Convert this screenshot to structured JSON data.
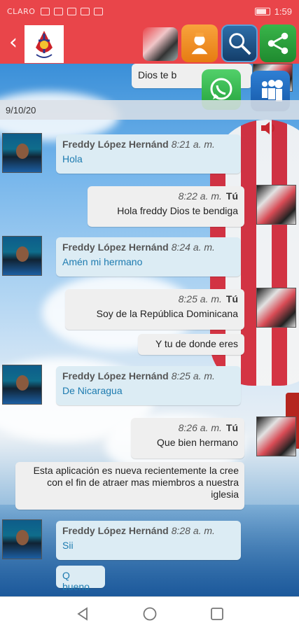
{
  "status_bar": {
    "carrier": "CLARO",
    "time": "1:59"
  },
  "app_bar": {
    "back_icon": "chevron-left-icon",
    "logo_icon": "church-logo",
    "buttons": [
      "profile-avatar",
      "contact-icon",
      "search-icon",
      "share-icon"
    ]
  },
  "overlay_buttons": [
    "whatsapp-icon",
    "myspace-icon"
  ],
  "date_separator": "9/10/20",
  "top_partial_message": {
    "text": "Dios te b"
  },
  "messages": [
    {
      "direction": "in",
      "name": "Freddy López Hernánd",
      "time": "8:21 a. m.",
      "text": "Hola"
    },
    {
      "direction": "out",
      "time": "8:22 a. m.",
      "sender": "Tú",
      "text": "Hola freddy Dios te bendiga"
    },
    {
      "direction": "in",
      "name": "Freddy López Hernánd",
      "time": "8:24 a. m.",
      "text": "Amén mi hermano"
    },
    {
      "direction": "out",
      "time": "8:25 a. m.",
      "sender": "Tú",
      "text": "Soy de la República Dominicana"
    },
    {
      "direction": "out-cont",
      "text": "Y tu de donde eres"
    },
    {
      "direction": "in",
      "name": "Freddy López Hernánd",
      "time": "8:25 a. m.",
      "text": "De Nicaragua"
    },
    {
      "direction": "out",
      "time": "8:26 a. m.",
      "sender": "Tú",
      "text": "Que bien hermano"
    },
    {
      "direction": "out-cont",
      "text": "Esta aplicación es nueva recientemente la cree con el fin de atraer mas miembros a nuestra iglesia"
    },
    {
      "direction": "in",
      "name": "Freddy López Hernánd",
      "time": "8:28 a. m.",
      "text": "Sii"
    },
    {
      "direction": "in-cont",
      "text": "Q bueno"
    }
  ],
  "nav_bar": [
    "back-nav-icon",
    "home-nav-icon",
    "recents-nav-icon"
  ]
}
